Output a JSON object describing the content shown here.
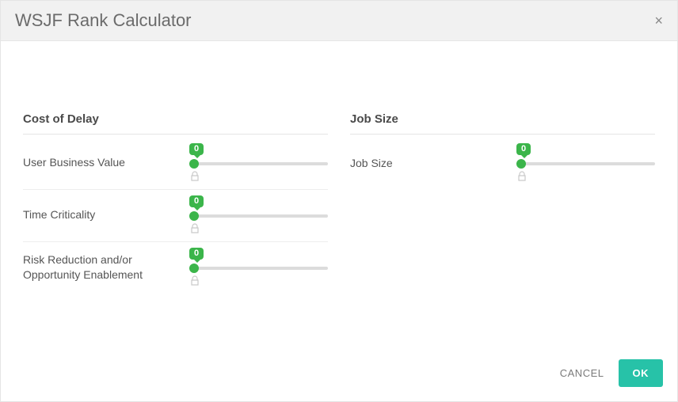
{
  "modal": {
    "title": "WSJF Rank Calculator",
    "close_icon": "×"
  },
  "cost_of_delay": {
    "heading": "Cost of Delay",
    "rows": [
      {
        "label": "User Business Value",
        "value": "0"
      },
      {
        "label": "Time Criticality",
        "value": "0"
      },
      {
        "label": "Risk Reduction and/or Opportunity Enablement",
        "value": "0"
      }
    ]
  },
  "job_size": {
    "heading": "Job Size",
    "rows": [
      {
        "label": "Job Size",
        "value": "0"
      }
    ]
  },
  "footer": {
    "cancel": "CANCEL",
    "ok": "OK"
  },
  "colors": {
    "accent_green": "#3bb54a",
    "ok_button": "#27c2a8"
  }
}
